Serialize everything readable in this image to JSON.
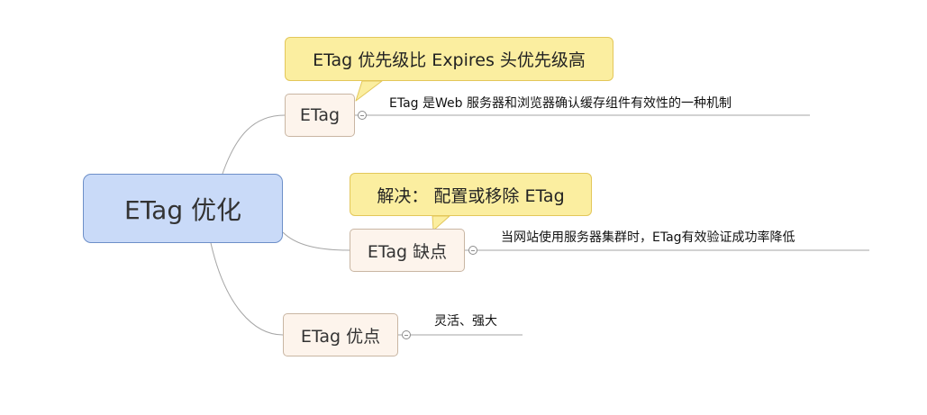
{
  "root": {
    "label": "ETag 优化"
  },
  "branches": [
    {
      "label": "ETag",
      "callout": "ETag 优先级比 Expires 头优先级高",
      "note": "ETag 是Web 服务器和浏览器确认缓存组件有效性的一种机制"
    },
    {
      "label": "ETag 缺点",
      "callout": "解决： 配置或移除 ETag",
      "note": "当网站使用服务器集群时，ETag有效验证成功率降低"
    },
    {
      "label": "ETag 优点",
      "note": "灵活、强大"
    }
  ],
  "colors": {
    "root_fill": "#c9daf8",
    "topic_fill": "#fdf4ec",
    "callout_fill": "#fbeea0",
    "connector": "#a6a6a6"
  }
}
